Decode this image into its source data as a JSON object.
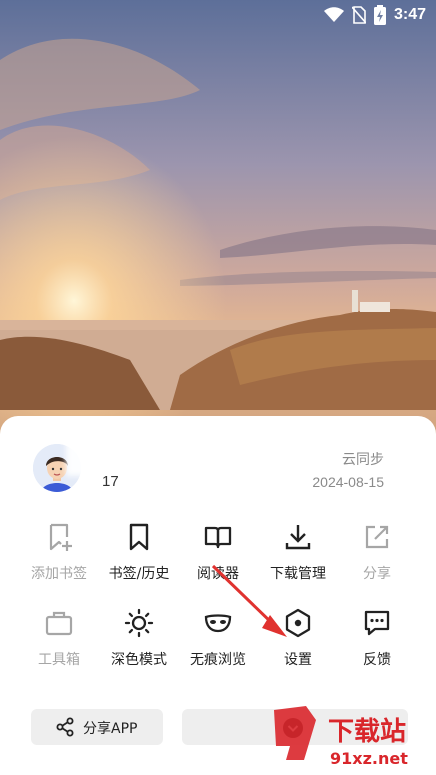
{
  "status_bar": {
    "time": "3:47",
    "icons": [
      "wifi-icon",
      "no-sim-icon",
      "battery-charging-icon"
    ]
  },
  "profile": {
    "user_id": "17",
    "cloud_sync_label": "云同步",
    "sync_date": "2024-08-15"
  },
  "menu": {
    "row1": [
      {
        "label": "添加书签",
        "icon": "bookmark-add-icon",
        "enabled": false
      },
      {
        "label": "书签/历史",
        "icon": "bookmark-icon",
        "enabled": true
      },
      {
        "label": "阅读器",
        "icon": "book-open-icon",
        "enabled": true
      },
      {
        "label": "下载管理",
        "icon": "download-icon",
        "enabled": true
      },
      {
        "label": "分享",
        "icon": "share-external-icon",
        "enabled": false
      }
    ],
    "row2": [
      {
        "label": "工具箱",
        "icon": "toolbox-icon",
        "enabled": false
      },
      {
        "label": "深色模式",
        "icon": "sun-icon",
        "enabled": true
      },
      {
        "label": "无痕浏览",
        "icon": "mask-icon",
        "enabled": true
      },
      {
        "label": "设置",
        "icon": "hexagon-settings-icon",
        "enabled": true
      },
      {
        "label": "反馈",
        "icon": "feedback-chat-icon",
        "enabled": true
      }
    ]
  },
  "bottom": {
    "share_app_label": "分享APP"
  },
  "watermark": {
    "main": "下载站",
    "sub": "91xz.net"
  },
  "colors": {
    "annotation_arrow": "#e0322f",
    "disabled_text": "#a6a6a6",
    "watermark_red": "#d9262b"
  }
}
